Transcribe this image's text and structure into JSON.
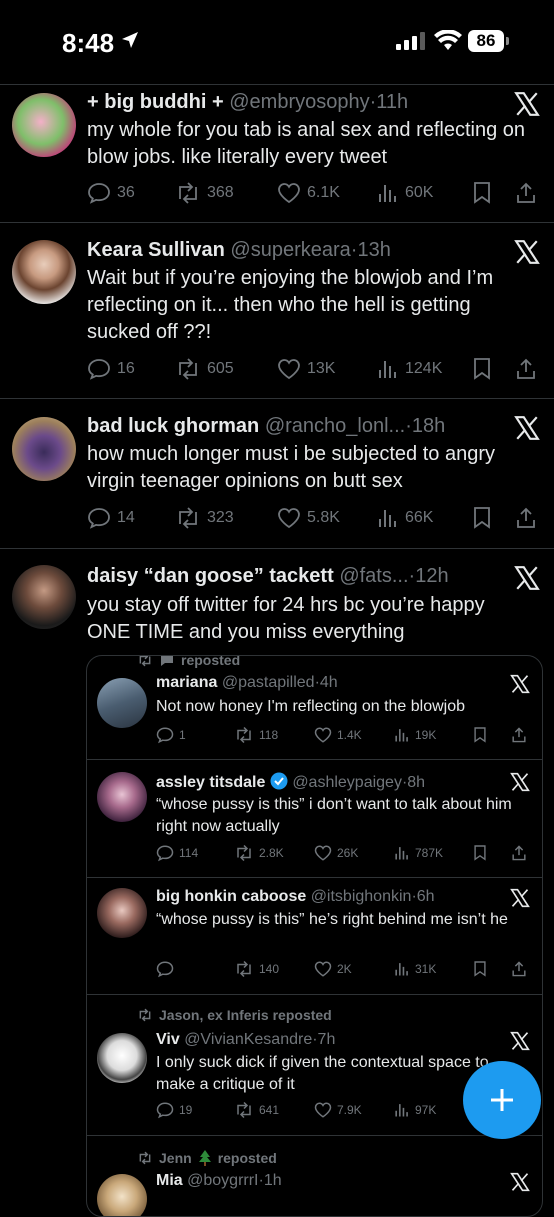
{
  "status_bar": {
    "time": "8:48",
    "battery": "86"
  },
  "tweets": [
    {
      "name": "+ big buddhi +",
      "handle": "@embryosophy",
      "time": "11h",
      "text": "my whole for you tab is anal sex and reflecting on blow jobs. like literally every tweet",
      "replies": "36",
      "reposts": "368",
      "likes": "6.1K",
      "views": "60K"
    },
    {
      "name": "Keara Sullivan",
      "handle": "@superkeara",
      "time": "13h",
      "text": "Wait but if you’re enjoying the blowjob and I’m reflecting on it... then who the hell is getting sucked off ??!",
      "replies": "16",
      "reposts": "605",
      "likes": "13K",
      "views": "124K"
    },
    {
      "name": "bad luck ghorman",
      "handle": "@rancho_lonl...",
      "time": "18h",
      "text": "how much longer must i be subjected to angry virgin teenager opinions on butt sex",
      "replies": "14",
      "reposts": "323",
      "likes": "5.8K",
      "views": "66K"
    },
    {
      "name": "daisy “dan goose” tackett",
      "handle": "@fats...",
      "time": "12h",
      "text": "you stay off twitter for 24 hrs bc you’re happy ONE TIME and you miss everything"
    }
  ],
  "quoted": {
    "top_repost": "reposted",
    "items": [
      {
        "name": "mariana",
        "handle": "@pastapilled",
        "time": "4h",
        "text": "Not now honey I'm reflecting on the blowjob",
        "replies": "1",
        "reposts": "118",
        "likes": "1.4K",
        "views": "19K"
      },
      {
        "name": "assley titsdale",
        "handle": "@ashleypaigey",
        "time": "8h",
        "text": "“whose pussy is this” i don’t want to talk about him right now actually",
        "replies": "114",
        "reposts": "2.8K",
        "likes": "26K",
        "views": "787K"
      },
      {
        "name": "big honkin caboose",
        "handle": "@itsbighonkin",
        "time": "6h",
        "text": "“whose pussy is this” he’s right behind me isn’t he",
        "replies": "",
        "reposts": "140",
        "likes": "2K",
        "views": "31K"
      },
      {
        "repost_label": "Jason, ex Inferis reposted",
        "name": "Viv",
        "handle": "@VivianKesandre",
        "time": "7h",
        "text": "I only suck dick if given the contextual space to make a critique of it",
        "replies": "19",
        "reposts": "641",
        "likes": "7.9K",
        "views": "97K"
      },
      {
        "repost_label_name": "Jenn",
        "repost_label_suffix": "reposted",
        "name": "Mia",
        "handle": "@boygrrrI",
        "time": "1h"
      }
    ]
  },
  "colors": {
    "background": "#000000",
    "text": "#e7e9ea",
    "muted": "#71767b",
    "accent": "#1d9bf0",
    "border": "#2f3336"
  }
}
